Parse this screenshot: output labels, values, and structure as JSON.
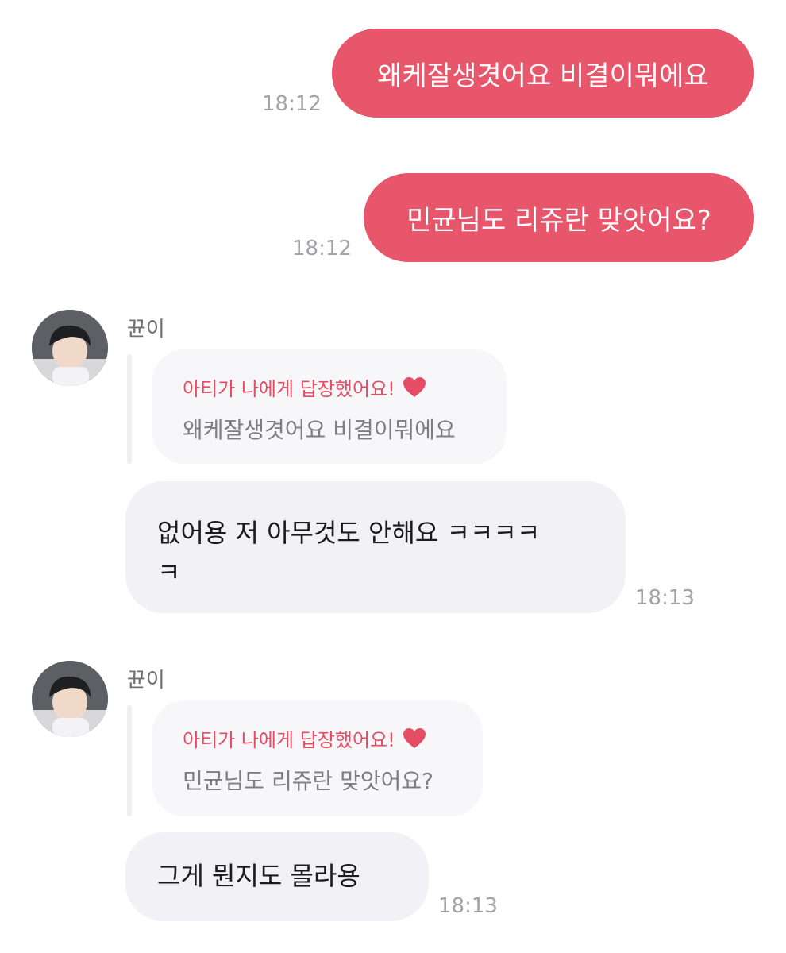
{
  "colors": {
    "outgoing_bubble": "#e8566c",
    "incoming_bubble": "#f2f2f6",
    "quote_card": "#f7f7fa",
    "reply_accent": "#e44d63",
    "timestamp": "#a2a2a8"
  },
  "messages": [
    {
      "type": "outgoing",
      "text": "왜케잘생겻어요 비결이뭐에요",
      "time": "18:12"
    },
    {
      "type": "outgoing",
      "text": "민균님도 리쥬란 맞앗어요?",
      "time": "18:12"
    },
    {
      "type": "incoming",
      "sender": "뀬이",
      "avatar_icon": "profile-photo",
      "reply_notice": "아티가 나에게 답장했어요!",
      "reply_icon": "heart-icon",
      "quoted_text": "왜케잘생겻어요 비결이뭐에요",
      "text_line1": "없어용 저 아무것도 안해요 ㅋㅋㅋㅋ",
      "text_line2": "ㅋ",
      "time": "18:13"
    },
    {
      "type": "incoming",
      "sender": "뀬이",
      "avatar_icon": "profile-photo",
      "reply_notice": "아티가 나에게 답장했어요!",
      "reply_icon": "heart-icon",
      "quoted_text": "민균님도 리쥬란 맞앗어요?",
      "text_line1": "그게 뭔지도 몰라용",
      "time": "18:13"
    }
  ]
}
